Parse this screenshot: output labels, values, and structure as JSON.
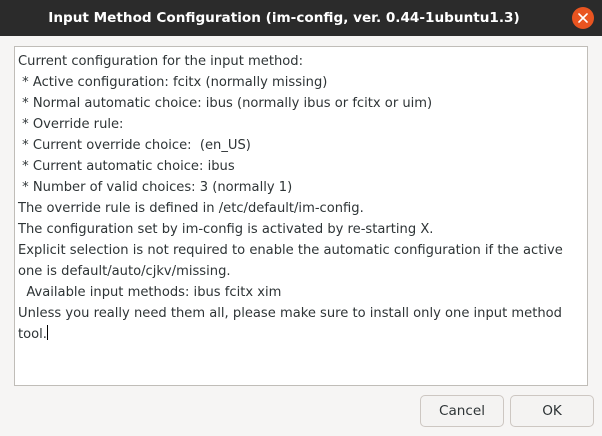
{
  "window": {
    "title": "Input Method Configuration (im-config, ver. 0.44-1ubuntu1.3)"
  },
  "content": {
    "lines": [
      "Current configuration for the input method:",
      " * Active configuration: fcitx (normally missing)",
      " * Normal automatic choice: ibus (normally ibus or fcitx or uim)",
      " * Override rule: ",
      " * Current override choice:  (en_US)",
      " * Current automatic choice: ibus",
      " * Number of valid choices: 3 (normally 1)",
      "The override rule is defined in /etc/default/im-config.",
      "The configuration set by im-config is activated by re-starting X.",
      "Explicit selection is not required to enable the automatic configuration if the active",
      "one is default/auto/cjkv/missing.",
      "  Available input methods: ibus fcitx xim",
      "Unless you really need them all, please make sure to install only one input method",
      "tool."
    ]
  },
  "buttons": {
    "cancel": "Cancel",
    "ok": "OK"
  },
  "colors": {
    "titlebar": "#2b2b2b",
    "close_button": "#e95420",
    "dialog_background": "#f6f5f4"
  },
  "icons": {
    "close": "close-icon"
  }
}
